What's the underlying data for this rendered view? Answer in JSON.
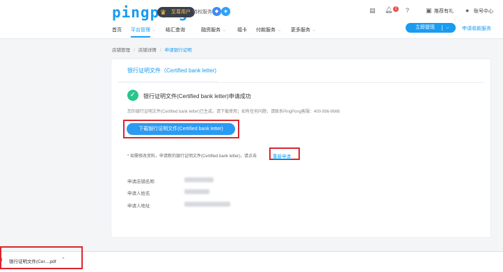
{
  "header": {
    "logo": "pingpong",
    "member_badge": "至尊用户",
    "privilege_label": "特权服务",
    "bell_count": "2",
    "recommend_label": "推荐有礼",
    "account_label": "账号中心"
  },
  "nav": {
    "items": [
      {
        "label": "首页",
        "has_chevron": false
      },
      {
        "label": "平台管理",
        "has_chevron": true,
        "active": true
      },
      {
        "label": "结汇查询",
        "has_chevron": false
      },
      {
        "label": "融资服务",
        "has_chevron": true
      },
      {
        "label": "福卡",
        "has_chevron": false
      },
      {
        "label": "付款服务",
        "has_chevron": true
      },
      {
        "label": "更多服务",
        "has_chevron": true
      }
    ],
    "withdraw_button": "立即提现",
    "collect_link": "申请收款服务"
  },
  "breadcrumb": {
    "items": [
      "店铺管理",
      "店铺详情",
      "申请银行证明"
    ]
  },
  "card": {
    "tab_label": "银行证明文件（Certified bank letter)",
    "success_title": "银行证明文件(Certified bank letter)申请成功",
    "success_desc": "您的银行证明文件(Certified bank letter)已生成，请下载使用；如有任何问题，请联系PingPong客服：400-996-9666",
    "download_button": "下载银行证明文件(Certified bank letter)",
    "reapply_prefix": "* 如需修改资料，申请新的银行证明文件(Certified bank letter)，请点击",
    "reapply_link": "重新申请",
    "info_labels": [
      "申请店铺名称",
      "申请人姓名",
      "申请人地址"
    ]
  },
  "download_bar": {
    "file_icon": "pdf-icon",
    "file_name": "银行证明文件(Cer....pdf"
  },
  "colors": {
    "primary": "#1a9bf0",
    "success": "#2ac58a",
    "highlight": "#d9252c"
  }
}
